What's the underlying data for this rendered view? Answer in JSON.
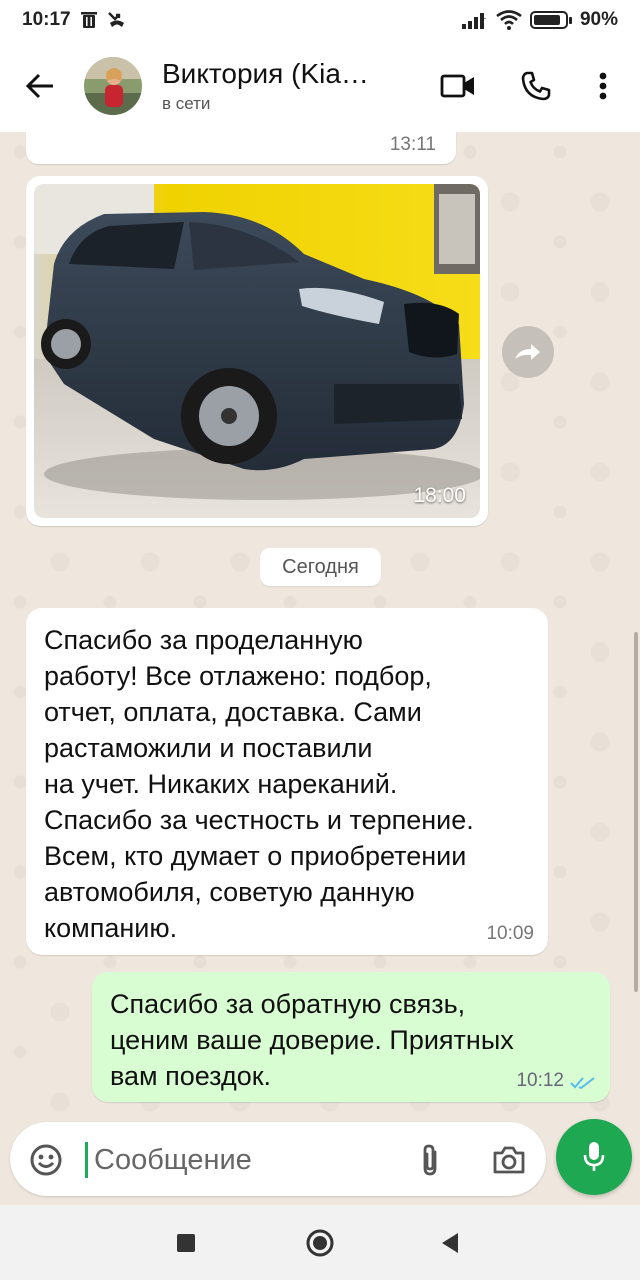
{
  "status_bar": {
    "time": "10:17",
    "battery": "90%",
    "battery_level": 0.9
  },
  "header": {
    "contact_name": "Виктория (Kia…",
    "status": "в сети"
  },
  "chat": {
    "previous_message_time": "13:11",
    "image_message": {
      "time": "18:00"
    },
    "day_divider": "Сегодня",
    "incoming_message": {
      "text": "Спасибо за проделанную\nработу! Все отлажено: подбор,\nотчет, оплата, доставка. Сами\nрастаможили и поставили\nна учет. Никаких нареканий.\nСпасибо за честность и терпение.\nВсем, кто думает о приобретении\nавтомобиля, советую данную\nкомпанию.",
      "time": "10:09"
    },
    "outgoing_message": {
      "text": "Спасибо за обратную связь,\nценим ваше доверие. Приятных\nвам поездок.",
      "time": "10:12",
      "read": true
    }
  },
  "composer": {
    "placeholder": "Сообщение"
  },
  "colors": {
    "outgoing_bubble": "#d9fdd3",
    "accent_green": "#1da851",
    "read_ticks": "#53bdeb",
    "chat_background": "#efe7dd"
  },
  "icons": [
    "back-arrow-icon",
    "video-call-icon",
    "phone-icon",
    "more-options-icon",
    "forward-icon",
    "emoji-icon",
    "attach-icon",
    "camera-icon",
    "mic-icon",
    "read-ticks-icon",
    "nav-square-icon",
    "nav-circle-icon",
    "nav-back-icon",
    "trash-icon",
    "missed-call-icon",
    "signal-icon",
    "wifi-icon",
    "battery-icon"
  ]
}
